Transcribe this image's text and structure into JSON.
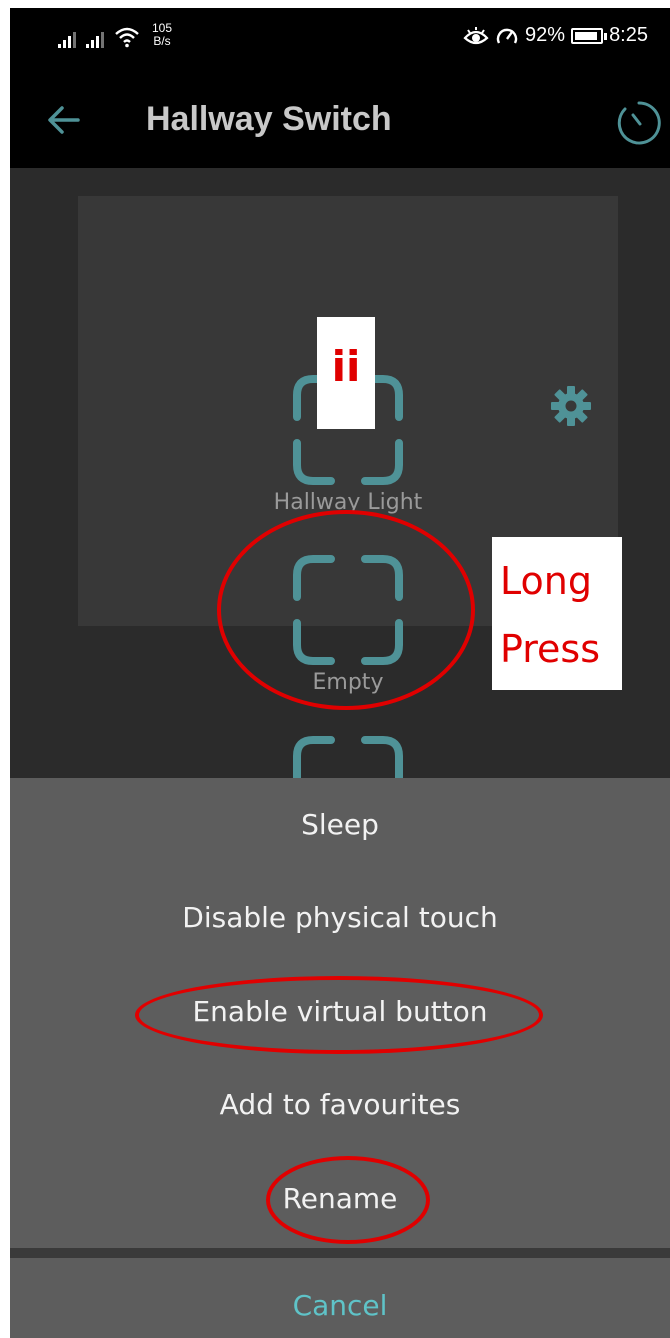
{
  "status_bar": {
    "net_speed_value": "105",
    "net_speed_unit": "B/s",
    "battery_text": "92%",
    "battery_level": 0.92,
    "time": "8:25"
  },
  "app_bar": {
    "title": "Hallway Switch",
    "back_icon": "arrow-left-icon",
    "timer_icon": "timer-icon"
  },
  "switch_panel": {
    "settings_icon": "gear-icon",
    "buttons": [
      {
        "label": "Hallway Light"
      },
      {
        "label": "Empty"
      },
      {
        "label": ""
      }
    ]
  },
  "annotations": {
    "step_label": "ii",
    "instruction_line1": "Long",
    "instruction_line2": "Press"
  },
  "menu": {
    "items": [
      {
        "label": "Sleep"
      },
      {
        "label": "Disable physical touch"
      },
      {
        "label": "Enable virtual button"
      },
      {
        "label": "Add to favourites"
      },
      {
        "label": "Rename"
      }
    ],
    "cancel_label": "Cancel"
  },
  "colors": {
    "accent": "#4f9297",
    "cancel_text": "#5fc3c8",
    "annotation_red": "#e00000",
    "sheet_bg": "#5d5d5d"
  }
}
